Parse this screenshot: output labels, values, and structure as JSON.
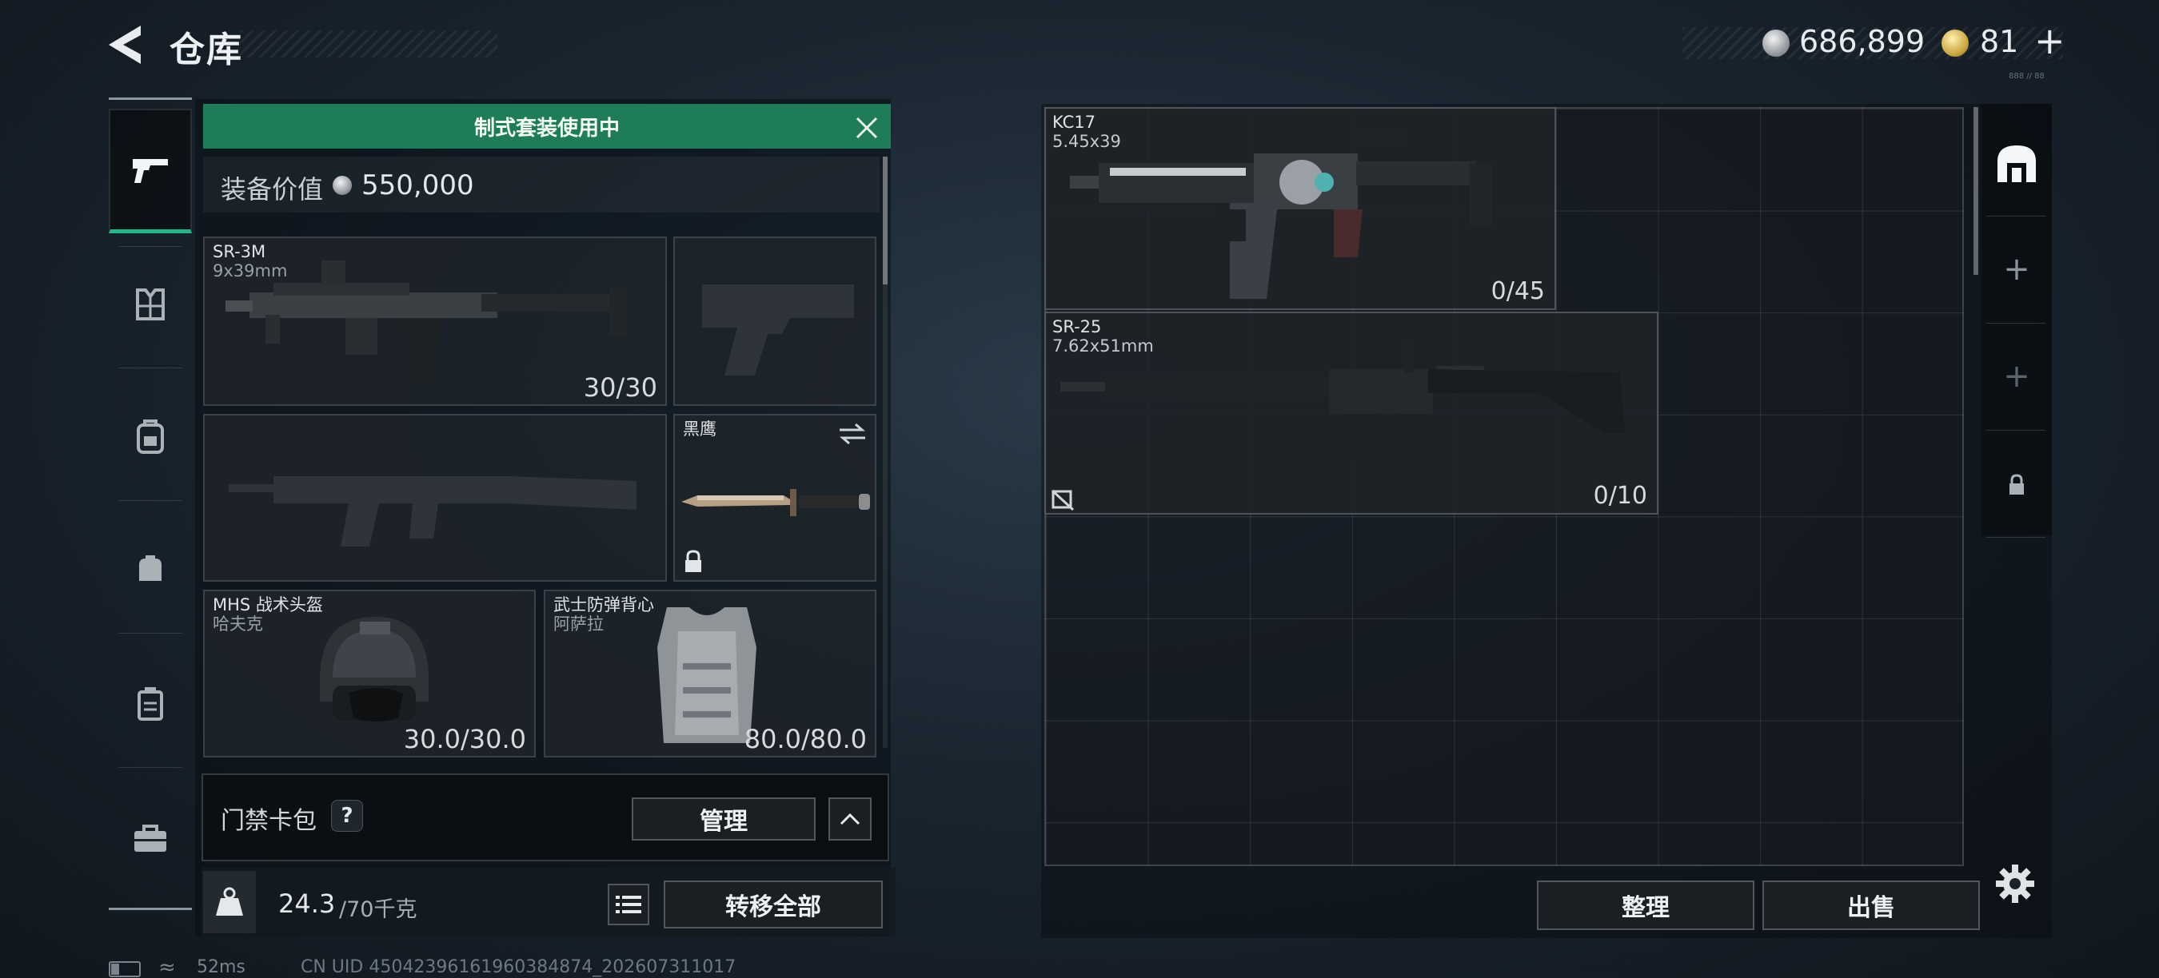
{
  "header": {
    "title": "仓库",
    "silver_amount": "686,899",
    "gold_amount": "81",
    "gold_plus": "+",
    "version_tag": "888 // 88"
  },
  "left_nav": {
    "items": [
      {
        "icon": "pistol-icon",
        "active": true
      },
      {
        "icon": "chest-rig-icon",
        "active": false
      },
      {
        "icon": "backpack-icon",
        "active": false
      },
      {
        "icon": "pouch-icon",
        "active": false
      },
      {
        "icon": "container-icon",
        "active": false
      },
      {
        "icon": "briefcase-icon",
        "active": false
      }
    ]
  },
  "loadout": {
    "banner": "制式套装使用中",
    "value_label": "装备价值",
    "value_amount": "550,000",
    "slots": {
      "primary": {
        "name": "SR-3M",
        "caliber": "9x39mm",
        "count": "30/30"
      },
      "pistol": {
        "name": "",
        "empty": true
      },
      "secondary": {
        "name": "",
        "empty": true
      },
      "melee": {
        "name": "黑鹰",
        "locked": true
      },
      "helmet": {
        "name": "MHS 战术头盔",
        "sub": "哈夫克",
        "durability": "30.0/30.0"
      },
      "armor": {
        "name": "武士防弹背心",
        "sub": "阿萨拉",
        "durability": "80.0/80.0"
      }
    },
    "keycard": {
      "label": "门禁卡包",
      "help": "?",
      "manage": "管理"
    },
    "weight": {
      "current": "24.3",
      "max": "/70千克"
    },
    "transfer_all": "转移全部"
  },
  "status_bar": {
    "ping": "52ms",
    "uid": "CN UID 4504239616196038487​4_202607311017"
  },
  "storage": {
    "items": [
      {
        "name": "KC17",
        "caliber": "5.45x39",
        "count": "0/45"
      },
      {
        "name": "SR-25",
        "caliber": "7.62x51mm",
        "count": "0/10"
      }
    ],
    "sort_label": "整理",
    "sell_label": "出售",
    "tabs": [
      {
        "icon": "storage-home-icon",
        "label": ""
      },
      {
        "icon": "add-icon",
        "label": "+"
      },
      {
        "icon": "add-icon",
        "label": "+"
      },
      {
        "icon": "lock-icon",
        "label": ""
      }
    ]
  },
  "colors": {
    "accent_green": "#1e7d57",
    "active_underline": "#1fb889"
  }
}
